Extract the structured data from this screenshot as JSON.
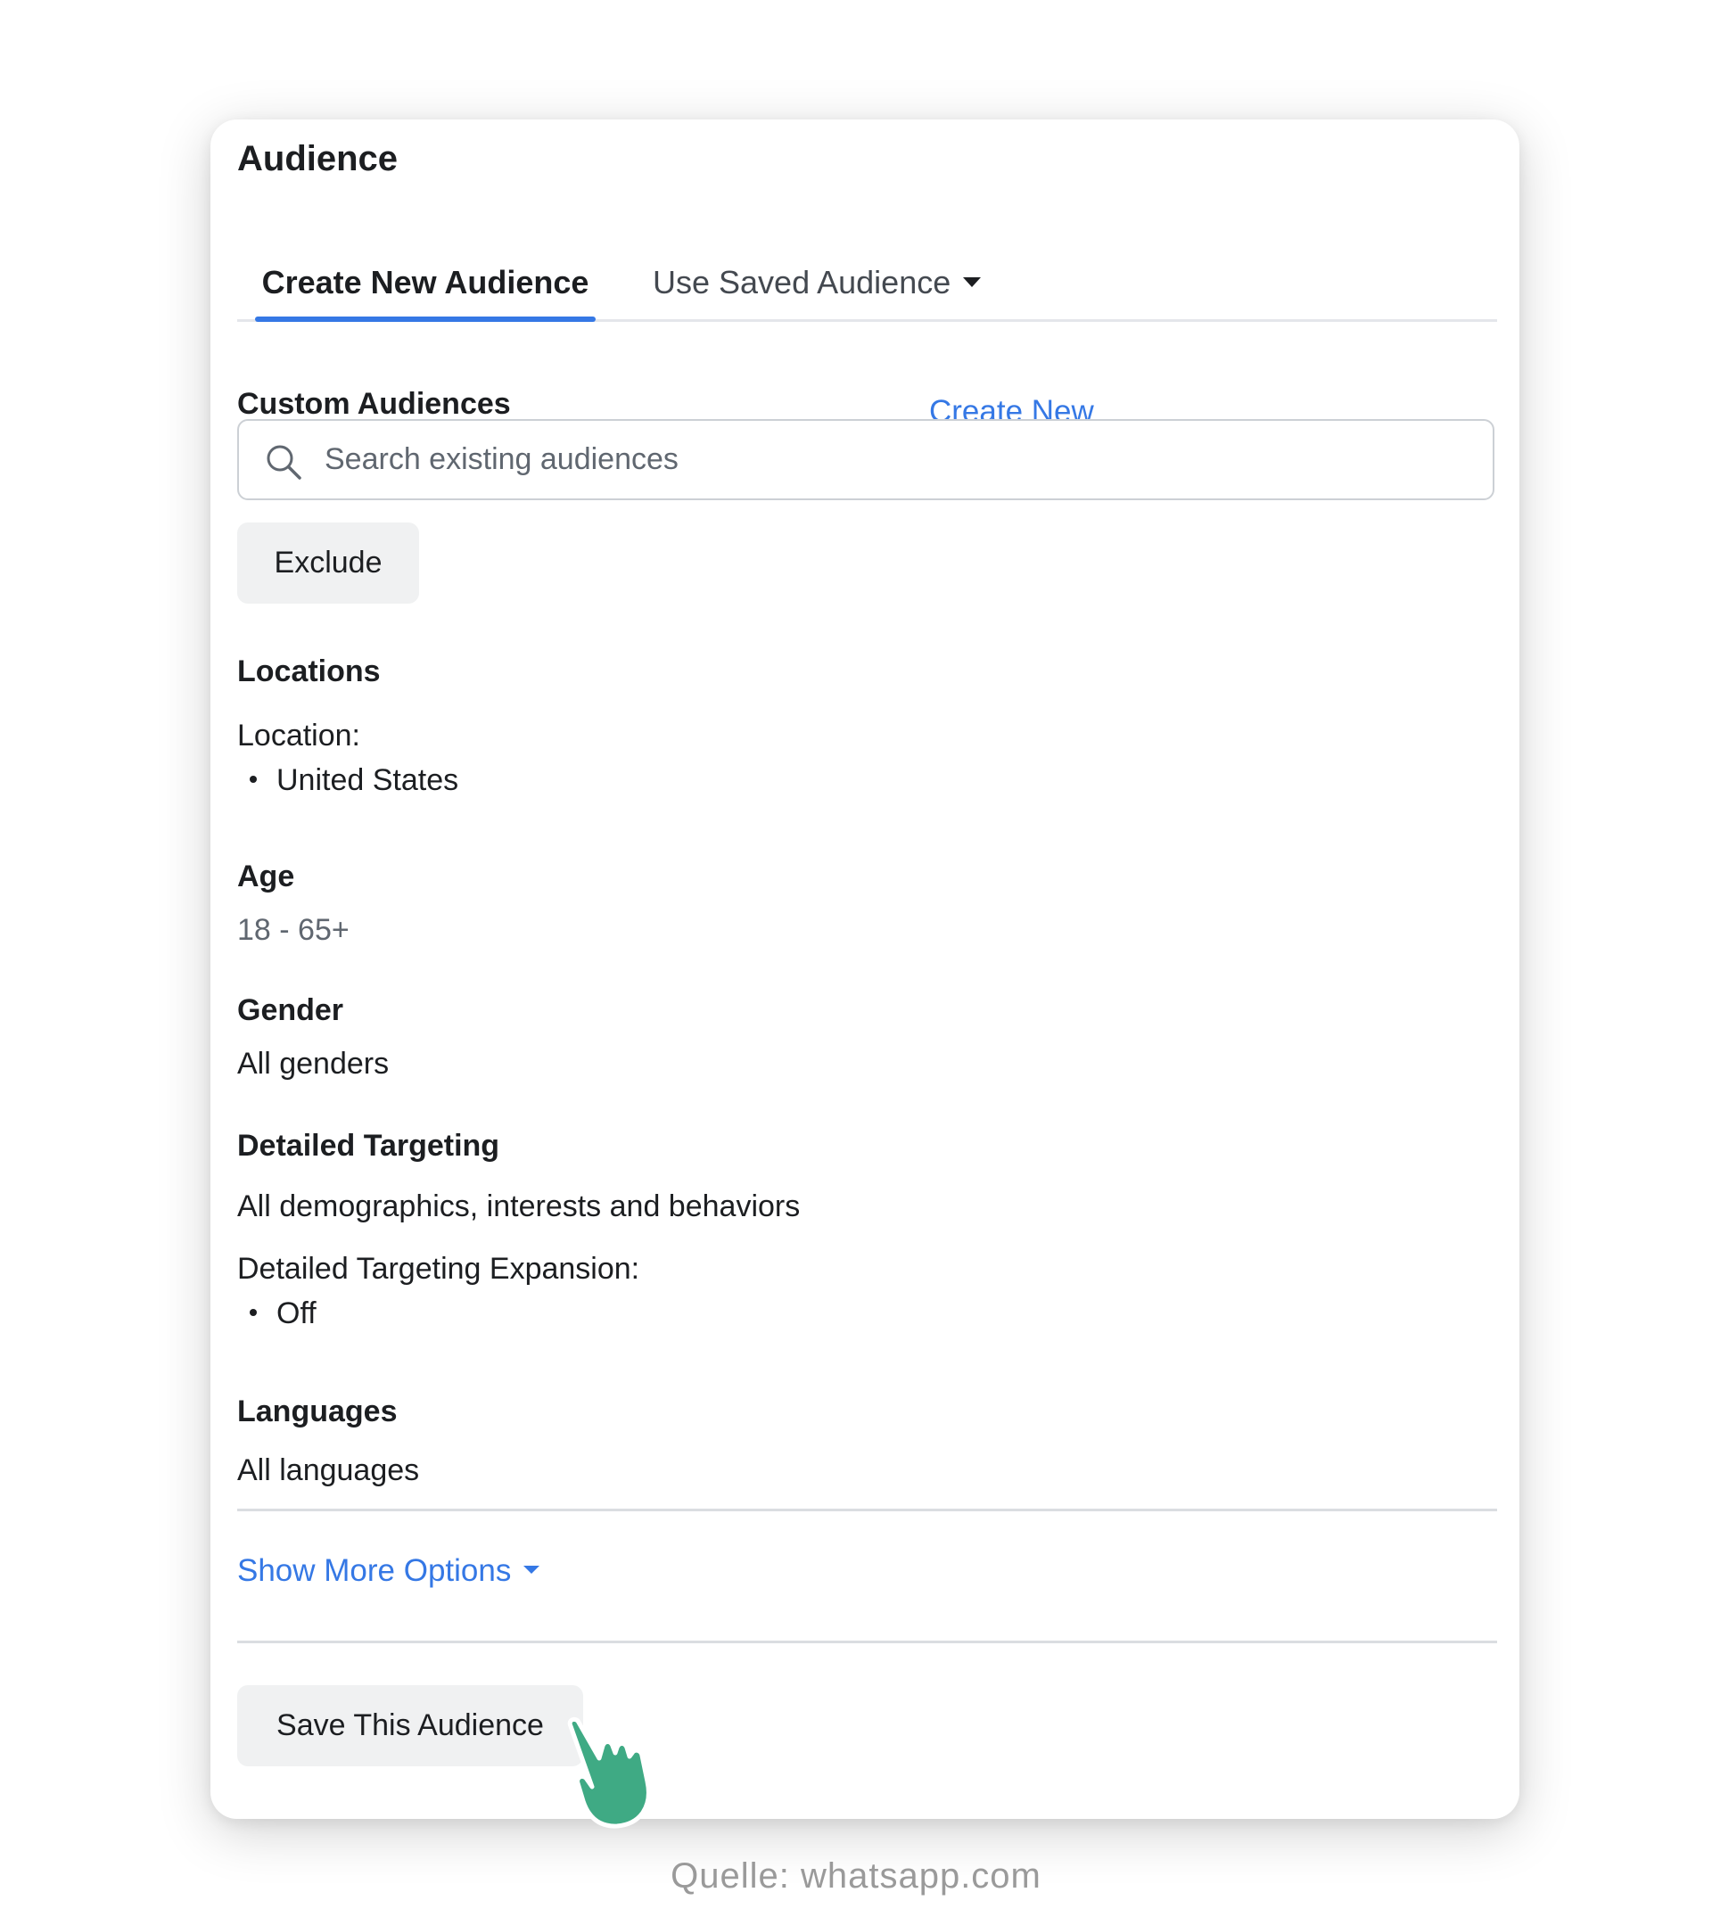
{
  "card": {
    "title": "Audience"
  },
  "tabs": [
    {
      "label": "Create New Audience",
      "active": true
    },
    {
      "label": "Use Saved Audience",
      "active": false
    }
  ],
  "custom_audiences": {
    "label": "Custom Audiences",
    "create_new_link": "Create New",
    "search_placeholder": "Search existing audiences",
    "exclude_button": "Exclude"
  },
  "locations": {
    "label": "Locations",
    "sub_label": "Location:",
    "items": [
      "United States"
    ]
  },
  "age": {
    "label": "Age",
    "value": "18 - 65+"
  },
  "gender": {
    "label": "Gender",
    "value": "All genders"
  },
  "detailed_targeting": {
    "label": "Detailed Targeting",
    "value": "All demographics, interests and behaviors",
    "expansion_label": "Detailed Targeting Expansion:",
    "expansion_items": [
      "Off"
    ]
  },
  "languages": {
    "label": "Languages",
    "value": "All languages"
  },
  "show_more_options": "Show More Options",
  "save_button": "Save This Audience",
  "caption": "Quelle: whatsapp.com",
  "icons": {
    "search": "search-icon",
    "tab_dropdown": "caret-down-icon",
    "show_more_dropdown": "caret-down-icon",
    "cursor": "hand-pointer-icon"
  },
  "colors": {
    "accent": "#3578e5",
    "cursor": "#3faa84",
    "button_bg": "#f0f1f2",
    "caption": "#9a9a9a"
  }
}
